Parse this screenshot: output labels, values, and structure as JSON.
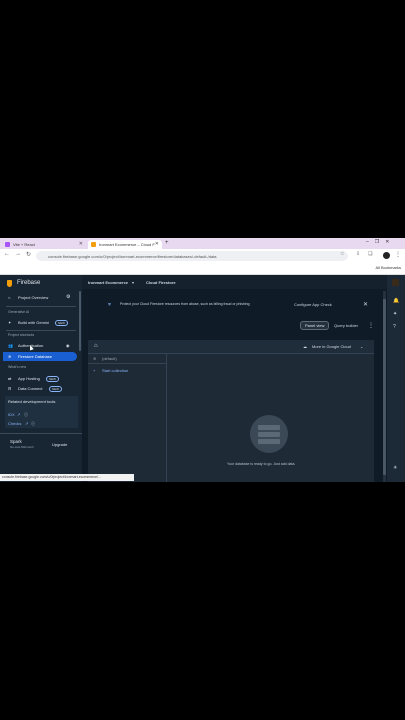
{
  "browser": {
    "tabs": [
      {
        "title": "Vite + React",
        "icon": "vite-icon"
      },
      {
        "title": "Ironmart Ecommerce – Cloud F",
        "icon": "firebase-icon"
      }
    ],
    "new_tab": "+",
    "url": "console.firebase.google.com/u/0/project/ironmart-ecommerce/firestore/databases/-default-/data",
    "bookmarks_label": "All Bookmarks",
    "status_url": "console.firebase.google.com/u/0/project/ironmart-ecommerce/..."
  },
  "sidebar": {
    "brand": "Firebase",
    "project_overview": "Project Overview",
    "section_genai": "Generative AI",
    "build_with_gemini": "Build with Gemini",
    "new_badge": "NEW",
    "section_shortcuts": "Project shortcuts",
    "authentication": "Authentication",
    "firestore": "Firestore Database",
    "section_whats_new": "What's new",
    "app_hosting": "App Hosting",
    "data_connect": "Data Connect",
    "related_title": "Related development tools",
    "idx": "IDX",
    "checks": "Checks",
    "plan_name": "Spark",
    "plan_detail": "No-cost $0/month",
    "upgrade": "Upgrade"
  },
  "topbar": {
    "project": "Ironmart Ecommerce",
    "product": "Cloud Firestore"
  },
  "banner": {
    "text": "Protect your Cloud Firestore resources from abuse, such as billing fraud or phishing",
    "action": "Configure App Check"
  },
  "toolbar": {
    "panel_view": "Panel view",
    "query_builder": "Query builder"
  },
  "panel": {
    "more_in_gcloud": "More in Google Cloud",
    "default_db": "(default)",
    "start_collection": "Start collection",
    "empty_message": "Your database is ready to go. Just add data."
  }
}
